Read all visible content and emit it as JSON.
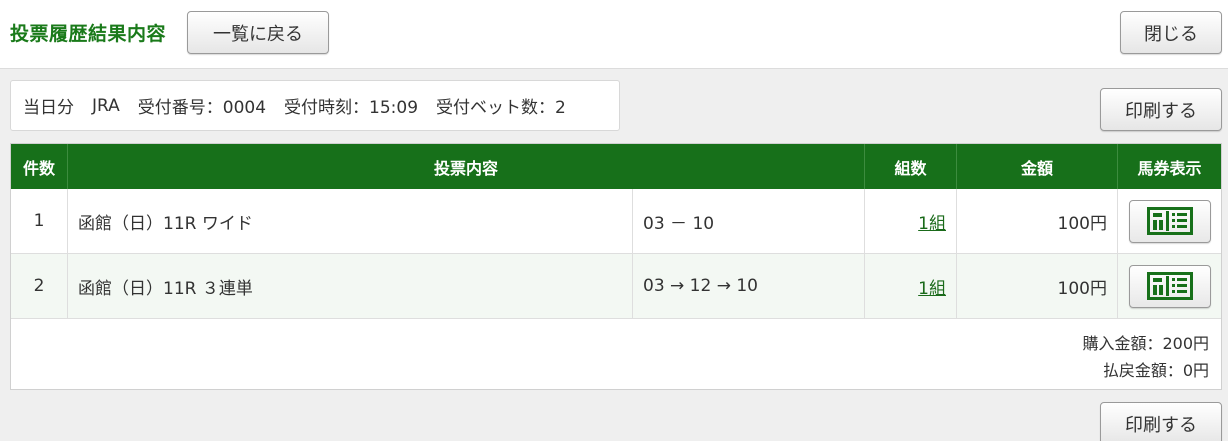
{
  "header": {
    "title": "投票履歴結果内容",
    "back_label": "一覧に戻る",
    "close_label": "閉じる"
  },
  "info": {
    "day": "当日分",
    "org": "JRA",
    "receipt_no": "受付番号：0004",
    "receipt_time": "受付時刻：15:09",
    "bet_count": "受付ベット数：2"
  },
  "print_label": "印刷する",
  "table": {
    "headers": {
      "count": "件数",
      "content": "投票内容",
      "kumi": "組数",
      "amount": "金額",
      "ticket": "馬券表示"
    },
    "rows": [
      {
        "num": "1",
        "race": "函館（日）11R ワイド",
        "horses": "03 － 10",
        "kumi": "1組",
        "amount": "100円"
      },
      {
        "num": "2",
        "race": "函館（日）11R ３連単",
        "horses": "03 → 12 → 10",
        "kumi": "1組",
        "amount": "100円"
      }
    ]
  },
  "summary": {
    "purchase": "購入金額：200円",
    "refund": "払戻金額：0円"
  },
  "colors": {
    "accent_green": "#17701a",
    "title_green": "#1a7a1a"
  },
  "icons": {
    "ticket": "ticket-icon"
  }
}
